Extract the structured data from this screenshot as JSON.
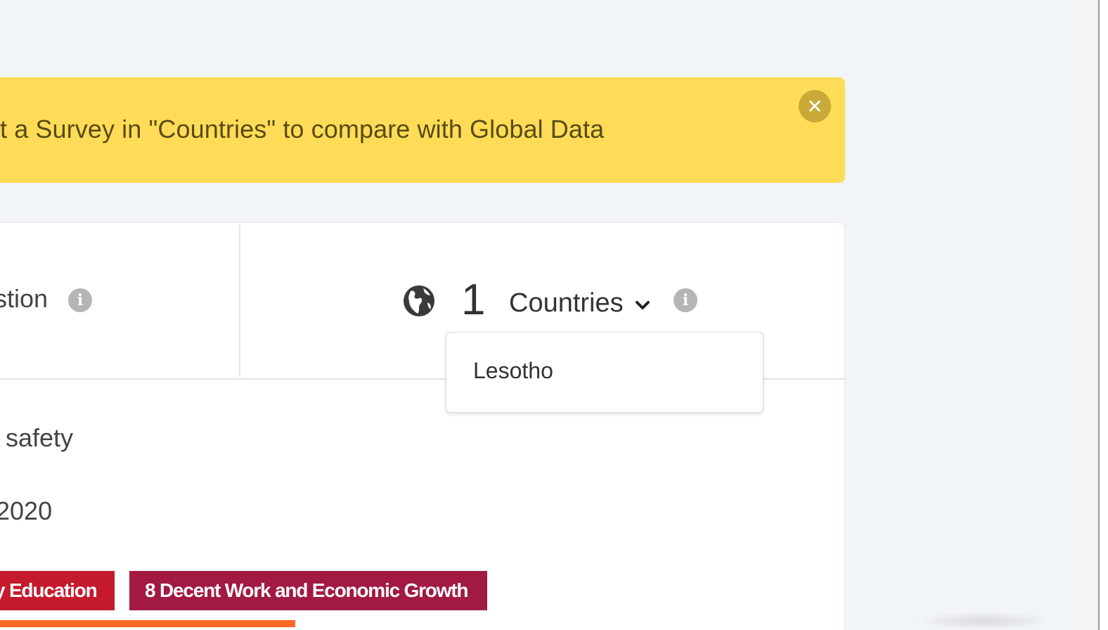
{
  "alert": {
    "message": "t a Survey in \"Countries\" to compare with Global Data",
    "close_symbol": "✕",
    "background_color": "#ffdc57"
  },
  "card": {
    "question_label": "stion",
    "info_symbol": "i",
    "countries": {
      "count": "1",
      "label": "Countries",
      "dropdown_open": true,
      "options": [
        "Lesotho"
      ]
    },
    "rows": {
      "safety": "t safety",
      "year": "2020"
    },
    "tags": [
      {
        "label": "y Education",
        "color": "#c5192d"
      },
      {
        "label": "8 Decent Work and Economic Growth",
        "color": "#a21942"
      }
    ],
    "accent_bar_color": "#fd6925"
  },
  "icons": {
    "globe": "globe-icon",
    "info": "info-icon",
    "chevron": "chevron-down-icon",
    "close": "close-icon"
  }
}
